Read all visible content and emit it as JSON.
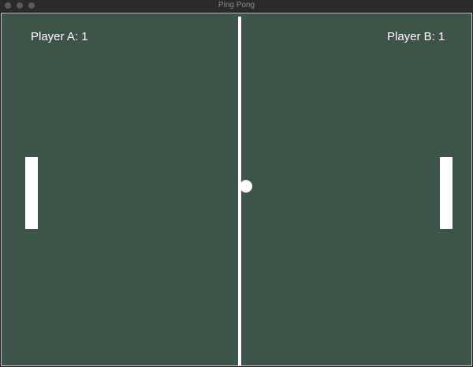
{
  "window": {
    "title": "Ping Pong"
  },
  "scores": {
    "player_a": "Player A: 1",
    "player_b": "Player B: 1"
  },
  "colors": {
    "field": "#3c5449",
    "foreground": "#ffffff"
  }
}
